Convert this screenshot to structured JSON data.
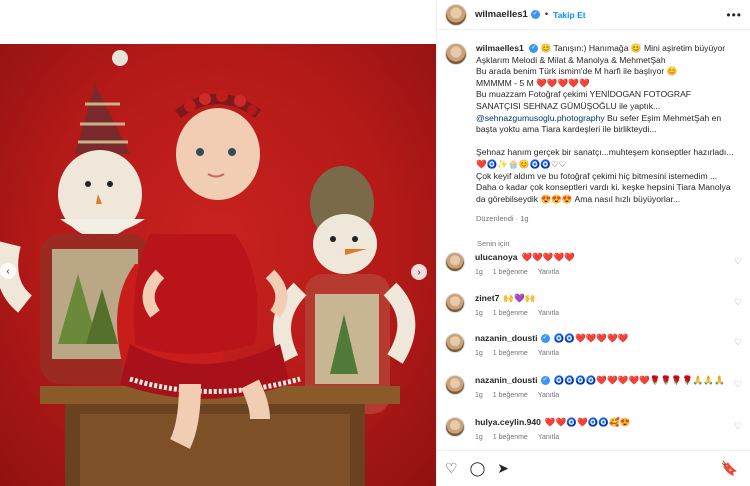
{
  "post": {
    "username": "wilmaelles1",
    "follow_label": "Takip Et",
    "more_label": "•••"
  },
  "caption": {
    "line1": "Tanışın:) Hanımağa",
    "line1b": "Mini aşiretim büyüyor",
    "line2": "Aşklarım Melodi & Milat & Manolya & MehmetŞah",
    "line3": "Bu arada benim Türk ismim'de M harfi ile başlıyor",
    "line4": "MMMMM - 5 M",
    "line5": "Bu muazzam Fotoğraf çekimi YENİDOGAN FOTOGRAF SANATÇISI SEHNAZ GÜMÜŞOĞLU ile yaptık...",
    "mention": "@sehnazgumusoglu.photography",
    "line6": "Bu sefer Eşim MehmetŞah en başta yoktu ama Tiara kardeşleri ile birlikteydi...",
    "line7": "Şehnaz hanım gerçek bir sanatçı...muhteşem konseptler hazırladı...",
    "line8": "Çok keyif aldım ve bu fotoğraf çekimi hiç bitmesini istemedim ...",
    "line9": "Daha o kadar çok konseptleri vardı ki. keşke hepsini Tiara Manolya da görebilseydik",
    "line9b": "Ama nasıl hızlı büyüyorlar...",
    "edited": "Düzenlendi · 1g"
  },
  "see_translation": "Senin için",
  "comments": [
    {
      "user": "ulucanoya",
      "text": "❤️❤️❤️❤️❤️",
      "time": "1g",
      "likes": "1 beğenme",
      "reply": "Yanıtla",
      "verified": false
    },
    {
      "user": "zinet7",
      "text": "🙌💜🙌",
      "time": "1g",
      "likes": "1 beğenme",
      "reply": "Yanıtla",
      "verified": false
    },
    {
      "user": "nazanin_dousti",
      "text": "🧿🧿❤️❤️❤️❤️❤️",
      "time": "1g",
      "likes": "1 beğenme",
      "reply": "Yanıtla",
      "verified": true
    },
    {
      "user": "nazanin_dousti",
      "text": "🧿🧿🧿🧿❤️❤️❤️❤️❤️🌹🌹🌹🌹🙏🙏🙏",
      "time": "1g",
      "likes": "1 beğenme",
      "reply": "Yanıtla",
      "verified": true
    },
    {
      "user": "hulya.ceylin.940",
      "text": "❤️❤️🧿❤️🧿🧿🥰😍",
      "time": "1g",
      "likes": "1 beğenme",
      "reply": "Yanıtla",
      "verified": false
    }
  ],
  "icons": {
    "like": "heart-icon",
    "comment": "comment-icon",
    "share": "share-icon",
    "save": "bookmark-icon"
  },
  "colors": {
    "link": "#0095f6",
    "background": "#b51a18"
  }
}
